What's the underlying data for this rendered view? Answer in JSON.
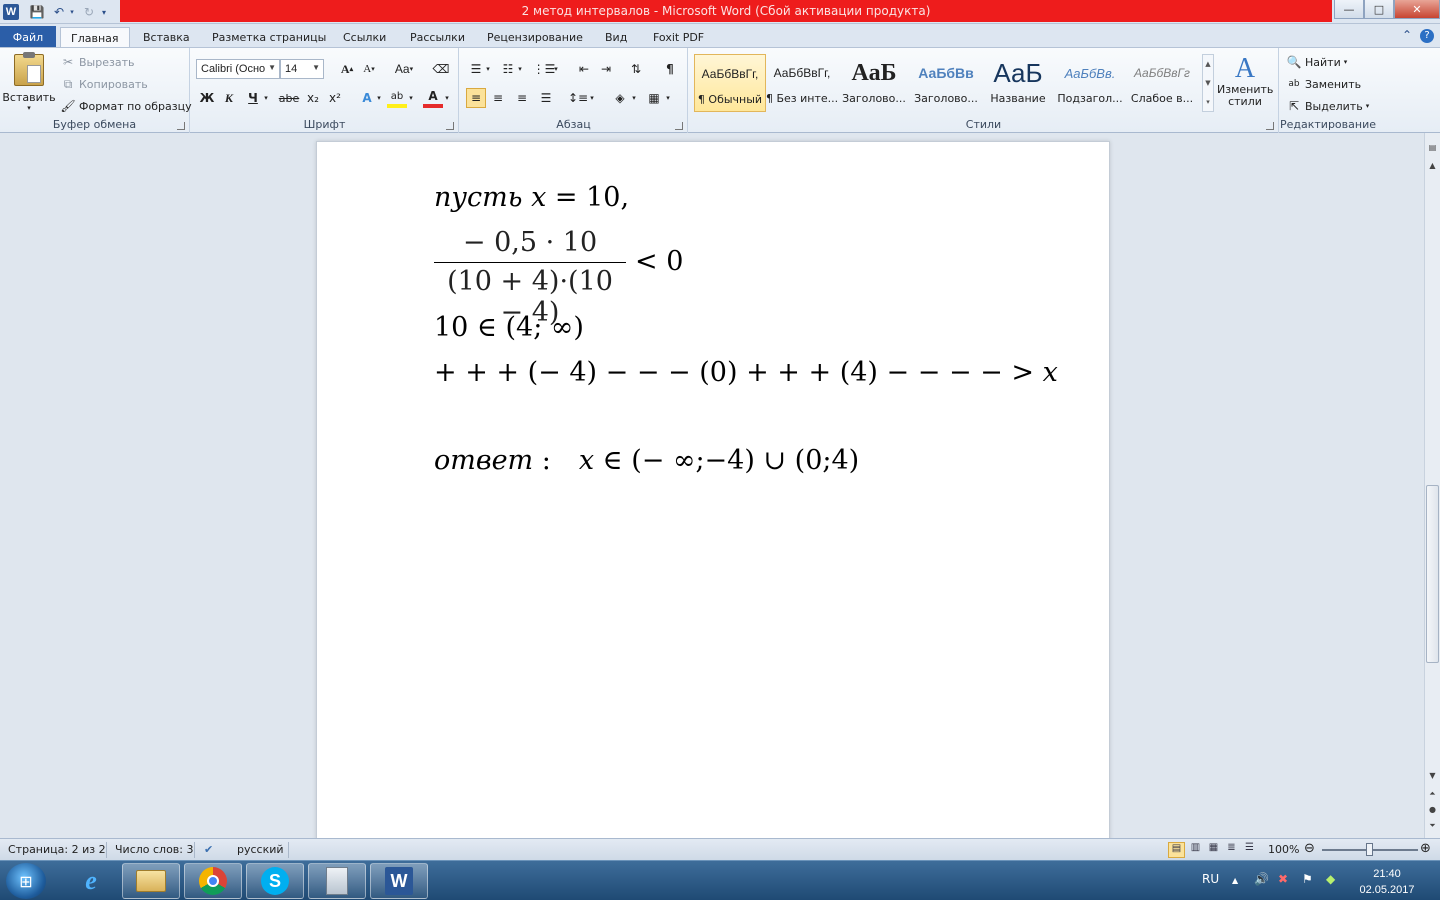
{
  "window": {
    "title": "2 метод интервалов  -  Microsoft Word (Сбой активации продукта)"
  },
  "quick_access": {
    "icons": [
      "word-logo-icon",
      "save-icon",
      "undo-icon",
      "redo-icon",
      "customize-icon"
    ]
  },
  "window_controls": {
    "minimize": "—",
    "maximize": "□",
    "close": "✕"
  },
  "ribbon_tabs": [
    {
      "label": "Файл"
    },
    {
      "label": "Главная"
    },
    {
      "label": "Вставка"
    },
    {
      "label": "Разметка страницы"
    },
    {
      "label": "Ссылки"
    },
    {
      "label": "Рассылки"
    },
    {
      "label": "Рецензирование"
    },
    {
      "label": "Вид"
    },
    {
      "label": "Foxit PDF"
    }
  ],
  "clipboard": {
    "group_label": "Буфер обмена",
    "paste": "Вставить",
    "cut": "Вырезать",
    "copy": "Копировать",
    "format_painter": "Формат по образцу"
  },
  "font": {
    "group_label": "Шрифт",
    "font_name": "Calibri (Осно",
    "font_size": "14",
    "case_btn": "Aa",
    "bold": "Ж",
    "italic": "К",
    "underline": "Ч",
    "strike": "abe",
    "subscript": "x₂",
    "superscript": "x²"
  },
  "paragraph": {
    "group_label": "Абзац",
    "pilcrow": "¶"
  },
  "styles": {
    "group_label": "Стили",
    "items": [
      {
        "sample": "АаБбВвГг,",
        "name": "¶ Обычный"
      },
      {
        "sample": "АаБбВвГг,",
        "name": "¶ Без инте..."
      },
      {
        "sample": "АаБ",
        "name": "Заголово..."
      },
      {
        "sample": "АаБбВв",
        "name": "Заголово..."
      },
      {
        "sample": "АаБ",
        "name": "Название"
      },
      {
        "sample": "АаБбВв.",
        "name": "Подзагол..."
      },
      {
        "sample": "АаБбВвГг",
        "name": "Слабое в..."
      }
    ],
    "change_styles": "Изменить стили"
  },
  "editing": {
    "group_label": "Редактирование",
    "find": "Найти",
    "replace": "Заменить",
    "select": "Выделить"
  },
  "document": {
    "line1": {
      "word": "пусть",
      "var": "x",
      "rest": " = 10,"
    },
    "fraction": {
      "numerator": "− 0,5 · 10",
      "denominator": "(10 + 4)·(10 − 4)",
      "rel": "< 0"
    },
    "line3": "10 ∈ (4; ∞)",
    "line4": {
      "text": "+ + + (− 4) − − − (0) + + + (4) − − − − > ",
      "var": "x"
    },
    "answer": {
      "word": "ответ",
      "colon": " :",
      "var": "x",
      "rest": " ∈ (− ∞;−4) ∪ (0;4)"
    }
  },
  "statusbar": {
    "page": "Страница: 2 из 2",
    "words": "Число слов: 3",
    "language": "русский",
    "zoom": "100%"
  },
  "taskbar": {
    "apps": [
      "start-orb",
      "internet-explorer",
      "file-explorer",
      "chrome",
      "skype",
      "calculator",
      "word"
    ],
    "language": "RU",
    "time": "21:40",
    "date": "02.05.2017"
  }
}
